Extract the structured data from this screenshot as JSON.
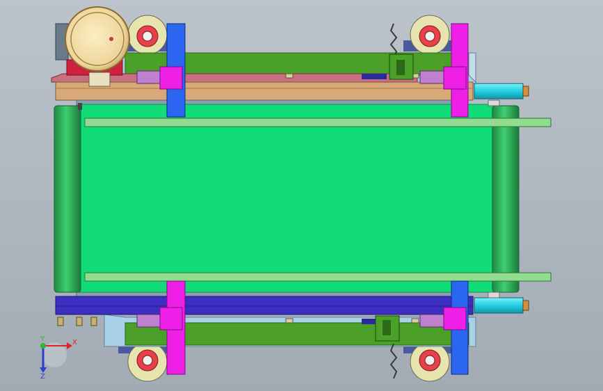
{
  "viewport": {
    "background_top": "#bcc3cb",
    "background_bottom": "#a2abb4"
  },
  "triad": {
    "x_label": "X",
    "y_label": "Y",
    "z_label": "Z",
    "x_color": "#e0202a",
    "y_color": "#2cb82c",
    "z_color": "#2a3ec8"
  },
  "colors": {
    "belt": "#12dc78",
    "belt_edge": "#0e8c4c",
    "roller": "#2fb55a",
    "guide_rail": "#90dd90",
    "frame_top": "#d8a878",
    "frame_bottom": "#3c2ec0",
    "side_plate": "#4aa028",
    "blue_column": "#2a66f0",
    "magenta_column": "#ee20e8",
    "cylinder": "#28d8e8",
    "motor": "#f4e0a8",
    "wheel_rim": "#e8e4b0",
    "wheel_hub": "#e8404a",
    "lavender_block": "#c080d0"
  }
}
